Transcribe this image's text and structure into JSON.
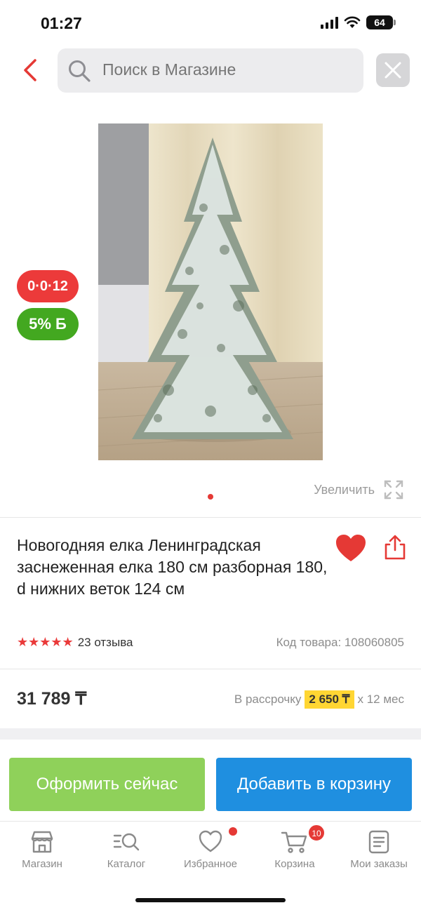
{
  "status_bar": {
    "time": "01:27",
    "battery": "64"
  },
  "search": {
    "placeholder": "Поиск в Магазине"
  },
  "badges": {
    "installment": "0·0·12",
    "bonus": "5% Б"
  },
  "gallery": {
    "zoom_label": "Увеличить"
  },
  "product": {
    "title": "Новогодняя елка Ленинградская заснеженная елка 180 см разборная 180, d нижних веток 124 см",
    "rating_stars": 5,
    "reviews": "23 отзыва",
    "sku": "Код товара: 108060805",
    "price": "31 789 ₸",
    "installment_prefix": "В рассрочку",
    "installment_amount": "2 650 ₸",
    "installment_suffix": "х 12 мес"
  },
  "actions": {
    "buy_now": "Оформить сейчас",
    "add_to_cart": "Добавить в корзину"
  },
  "bottom_nav": {
    "items": [
      {
        "label": "Магазин",
        "icon": "store-icon"
      },
      {
        "label": "Каталог",
        "icon": "catalog-icon"
      },
      {
        "label": "Избранное",
        "icon": "heart-icon"
      },
      {
        "label": "Корзина",
        "icon": "cart-icon"
      },
      {
        "label": "Мои заказы",
        "icon": "orders-icon"
      }
    ],
    "cart_count": "10"
  },
  "colors": {
    "accent_red": "#e53935",
    "buy_green": "#8fd15a",
    "cart_blue": "#1f8fe0",
    "installment_yellow": "#ffd633"
  }
}
